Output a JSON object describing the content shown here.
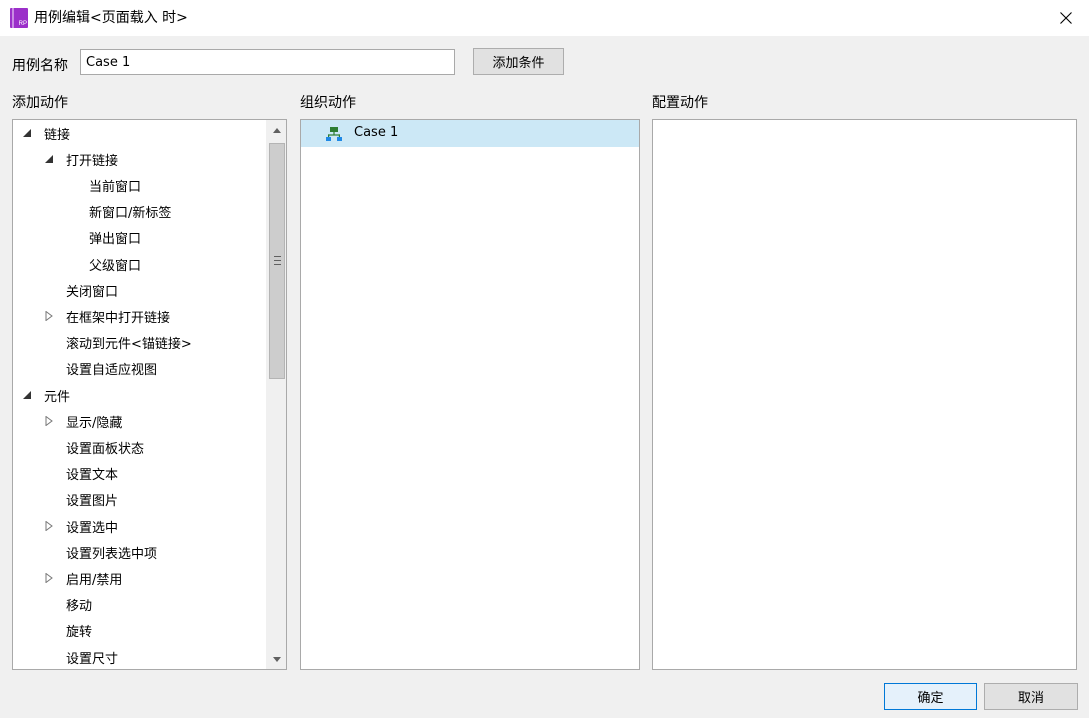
{
  "window": {
    "title": "用例编辑<页面载入 时>",
    "app_icon_text": "RP",
    "accent_color": "#9b2fc9"
  },
  "case_name": {
    "label": "用例名称",
    "value": "Case 1"
  },
  "add_condition_label": "添加条件",
  "sections": {
    "add_action": "添加动作",
    "organize_action": "组织动作",
    "configure_action": "配置动作"
  },
  "tree": [
    {
      "label": "链接",
      "level": 0,
      "arrow": "expanded"
    },
    {
      "label": "打开链接",
      "level": 1,
      "arrow": "expanded"
    },
    {
      "label": "当前窗口",
      "level": 2,
      "arrow": "none"
    },
    {
      "label": "新窗口/新标签",
      "level": 2,
      "arrow": "none"
    },
    {
      "label": "弹出窗口",
      "level": 2,
      "arrow": "none"
    },
    {
      "label": "父级窗口",
      "level": 2,
      "arrow": "none"
    },
    {
      "label": "关闭窗口",
      "level": 1,
      "arrow": "none"
    },
    {
      "label": "在框架中打开链接",
      "level": 1,
      "arrow": "collapsed"
    },
    {
      "label": "滚动到元件<锚链接>",
      "level": 1,
      "arrow": "none"
    },
    {
      "label": "设置自适应视图",
      "level": 1,
      "arrow": "none"
    },
    {
      "label": "元件",
      "level": 0,
      "arrow": "expanded"
    },
    {
      "label": "显示/隐藏",
      "level": 1,
      "arrow": "collapsed"
    },
    {
      "label": "设置面板状态",
      "level": 1,
      "arrow": "none"
    },
    {
      "label": "设置文本",
      "level": 1,
      "arrow": "none"
    },
    {
      "label": "设置图片",
      "level": 1,
      "arrow": "none"
    },
    {
      "label": "设置选中",
      "level": 1,
      "arrow": "collapsed"
    },
    {
      "label": "设置列表选中项",
      "level": 1,
      "arrow": "none"
    },
    {
      "label": "启用/禁用",
      "level": 1,
      "arrow": "collapsed"
    },
    {
      "label": "移动",
      "level": 1,
      "arrow": "none"
    },
    {
      "label": "旋转",
      "level": 1,
      "arrow": "none"
    },
    {
      "label": "设置尺寸",
      "level": 1,
      "arrow": "none"
    }
  ],
  "organize": {
    "case_label": "Case 1",
    "case_icon": "case-tree-icon",
    "highlight_color": "#cce8f6"
  },
  "buttons": {
    "ok": "确定",
    "cancel": "取消"
  }
}
